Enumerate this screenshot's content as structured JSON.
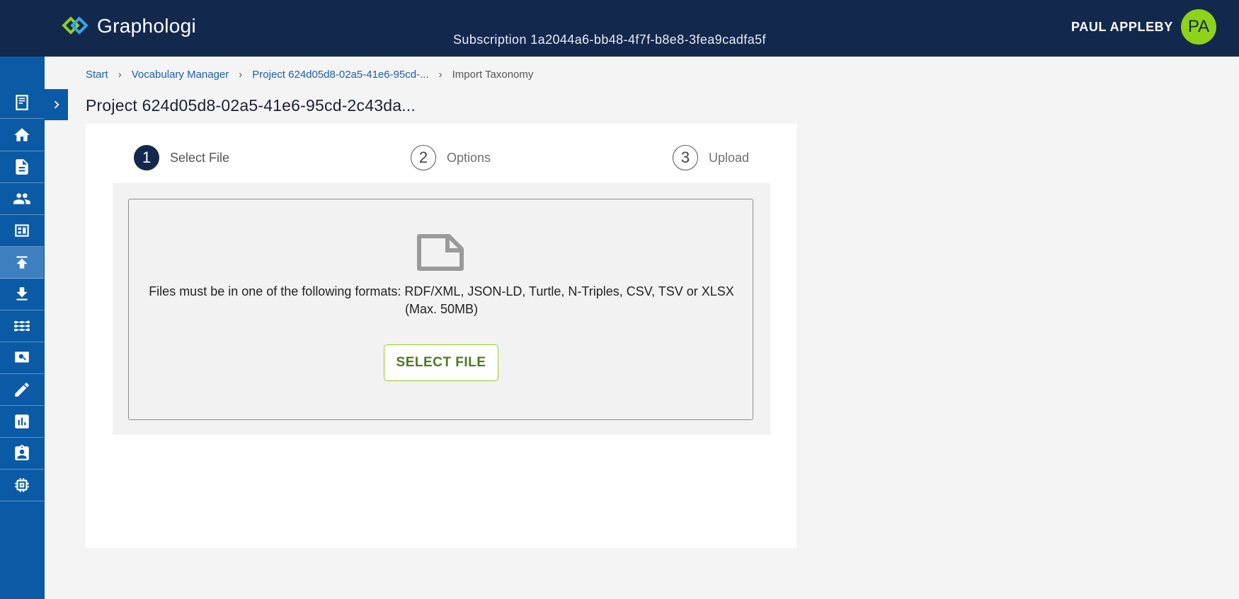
{
  "header": {
    "logo_text": "Graphologi",
    "subscription": "Subscription 1a2044a6-bb48-4f7f-b8e8-3fea9cadfa5f",
    "user_name": "PAUL APPLEBY",
    "avatar_initials": "PA"
  },
  "sidebar": {
    "items": [
      {
        "icon": "notebook-icon"
      },
      {
        "icon": "home-icon"
      },
      {
        "icon": "document-icon"
      },
      {
        "icon": "people-icon"
      },
      {
        "icon": "dashboard-icon"
      },
      {
        "icon": "upload-icon"
      },
      {
        "icon": "download-icon"
      },
      {
        "icon": "waves-icon"
      },
      {
        "icon": "search-icon"
      },
      {
        "icon": "edit-icon"
      },
      {
        "icon": "chart-icon"
      },
      {
        "icon": "assignment-icon"
      },
      {
        "icon": "chip-icon"
      }
    ],
    "active_icon": "upload-icon"
  },
  "breadcrumb": {
    "items": [
      "Start",
      "Vocabulary Manager",
      "Project 624d05d8-02a5-41e6-95cd-...",
      "Import Taxonomy"
    ]
  },
  "page": {
    "title": "Project 624d05d8-02a5-41e6-95cd-2c43da..."
  },
  "stepper": {
    "steps": [
      {
        "number": "1",
        "label": "Select File"
      },
      {
        "number": "2",
        "label": "Options"
      },
      {
        "number": "3",
        "label": "Upload"
      }
    ],
    "current_step": 1
  },
  "upload": {
    "formats_line1": "Files must be in one of the following formats: RDF/XML, JSON-LD, Turtle, N-Triples, CSV, TSV or XLSX",
    "formats_line2": "(Max. 50MB)",
    "select_button": "SELECT FILE"
  },
  "colors": {
    "header_bg": "#13284d",
    "sidebar_bg": "#0b5aa6",
    "accent_green": "#8fd21a",
    "link_blue": "#1a5fb4"
  }
}
